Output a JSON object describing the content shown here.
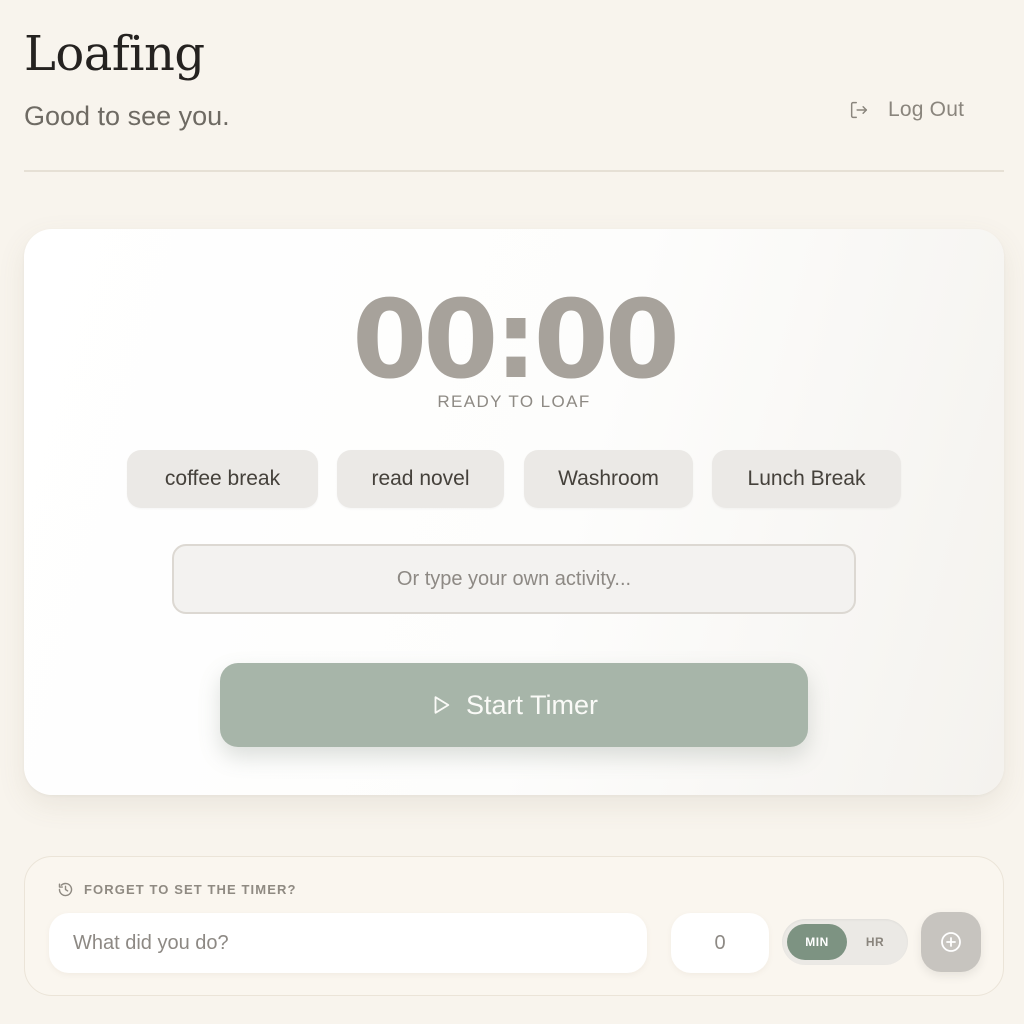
{
  "header": {
    "brand": "Loafing",
    "greeting": "Good to see you.",
    "logout_label": "Log Out",
    "logout_icon": "log-out-icon"
  },
  "timer": {
    "display": "00:00",
    "status": "READY TO LOAF",
    "quick_activities": [
      "coffee break",
      "read novel",
      "Washroom",
      "Lunch Break"
    ],
    "custom_activity": {
      "value": "",
      "placeholder": "Or type your own activity..."
    },
    "start_label": "Start Timer",
    "start_icon": "play-icon"
  },
  "manual_entry": {
    "title": "FORGET TO SET THE TIMER?",
    "title_icon": "history-icon",
    "activity": {
      "value": "",
      "placeholder": "What did you do?"
    },
    "duration": {
      "value": "0"
    },
    "units": [
      {
        "label": "MIN",
        "selected": true
      },
      {
        "label": "HR",
        "selected": false
      }
    ],
    "add_icon": "plus-circle-icon"
  },
  "colors": {
    "background": "#f8f4ed",
    "accent_sage": "#a7b5a9",
    "toggle_active": "#7d9382",
    "timer_text": "#a7a29b",
    "heading_text": "#252220"
  }
}
